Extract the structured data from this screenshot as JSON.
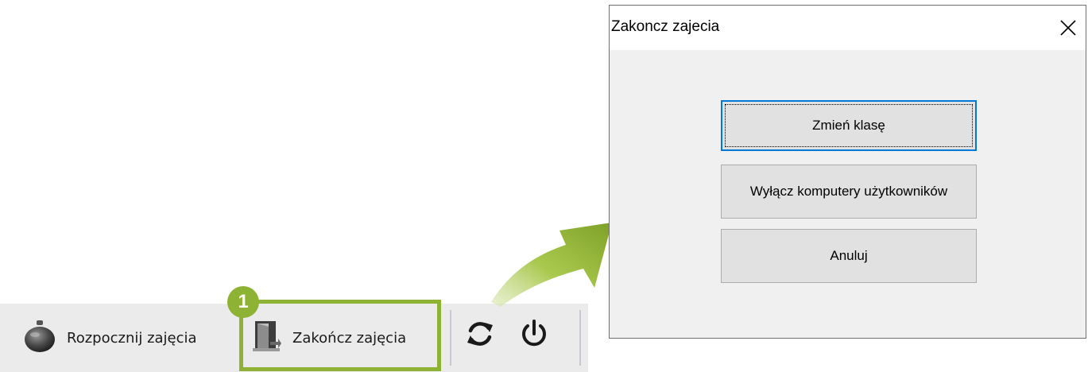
{
  "toolbar": {
    "start_label": "Rozpocznij zajęcia",
    "end_label": "Zakończ zajęcia",
    "step_number": "1"
  },
  "dialog": {
    "title": "Zakoncz zajecia",
    "buttons": {
      "change_class": "Zmień klasę",
      "shutdown_users": "Wyłącz komputery użytkowników",
      "cancel": "Anuluj"
    }
  },
  "colors": {
    "accent_green": "#8eb334",
    "focus_blue": "#0078d7"
  },
  "icons": {
    "start": "bell-icon",
    "end": "door-exit-icon",
    "refresh": "refresh-icon",
    "power": "power-icon",
    "close": "close-icon"
  }
}
